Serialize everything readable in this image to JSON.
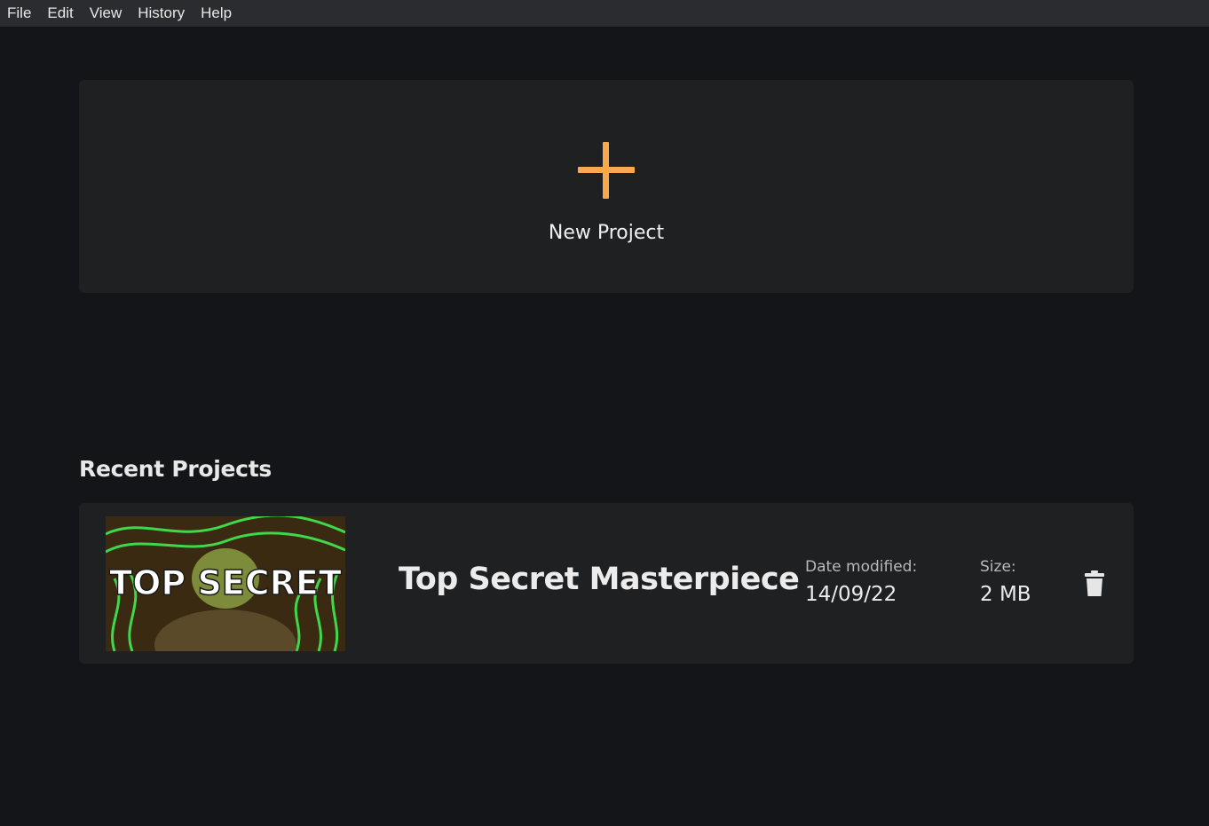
{
  "menubar": {
    "items": [
      "File",
      "Edit",
      "View",
      "History",
      "Help"
    ]
  },
  "new_project": {
    "label": "New Project",
    "icon": "plus-icon",
    "accent_color": "#f7a94d"
  },
  "recent": {
    "title": "Recent Projects",
    "projects": [
      {
        "thumbnail_text": "TOP SECRET",
        "name": "Top Secret Masterpiece",
        "date_label": "Date modified:",
        "date_value": "14/09/22",
        "size_label": "Size:",
        "size_value": "2 MB",
        "delete_icon": "trash-icon"
      }
    ]
  }
}
